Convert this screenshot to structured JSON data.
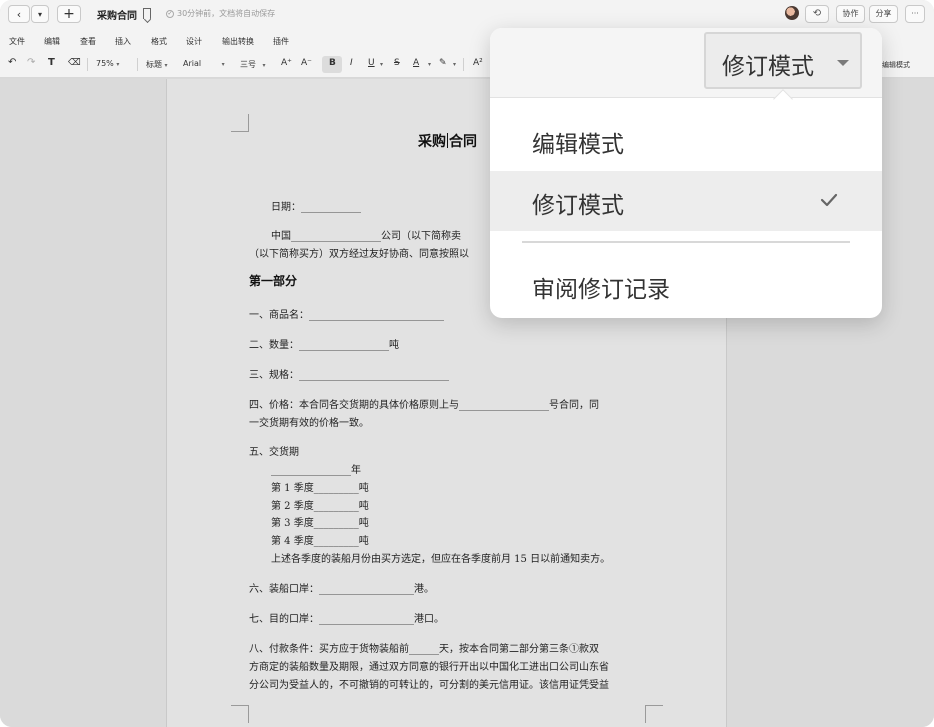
{
  "titlebar": {
    "back_icon": "‹",
    "dropdown_icon": "▾",
    "new_icon": "+",
    "doc_title": "采购合同",
    "save_status": "30分钟前，文档将自动保存",
    "history_icon": "⟲",
    "collab_label": "协作",
    "share_label": "分享",
    "more_icon": "···"
  },
  "menubar": {
    "items": [
      "文件",
      "编辑",
      "查看",
      "插入",
      "格式",
      "设计",
      "输出转换",
      "插件"
    ]
  },
  "toolbar": {
    "undo": "↶",
    "redo": "↷",
    "format_painter": "T",
    "eraser": "⌫",
    "zoom": "75%",
    "style": "标题",
    "font": "Arial",
    "size": "三号",
    "grow": "A⁺",
    "shrink": "A⁻",
    "bold": "B",
    "italic": "I",
    "underline": "U",
    "strike": "S",
    "font_color": "A",
    "highlight": "✎",
    "superscript": "A²",
    "mode_right": "编辑模式"
  },
  "document": {
    "title_a": "采购",
    "title_b": "合同",
    "date": "日期：____________",
    "intro1": "中国__________________公司（以下简称卖",
    "intro2": "（以下简称买方）双方经过友好协商、同意按照以",
    "part1": "第一部分",
    "item1": "一、商品名：___________________________",
    "item2": "二、数量：__________________吨",
    "item3": "三、规格：______________________________",
    "item4a": "四、价格：本合同各交货期的具体价格原则上与__________________号合同，同",
    "item4b": "一交货期有效的价格一致。",
    "item5": "五、交货期",
    "item5_year": "________________年",
    "q1": "第 1 季度_________吨",
    "q2": "第 2 季度_________吨",
    "q3": "第 3 季度_________吨",
    "q4": "第 4 季度_________吨",
    "item5_note": "上述各季度的装船月份由买方选定，但应在各季度前月 15 日以前通知卖方。",
    "item6": "六、装船口岸：___________________港。",
    "item7": "七、目的口岸：___________________港口。",
    "item8a": "八、付款条件：买方应于货物装船前______天，按本合同第二部分第三条①款双",
    "item8b": "方商定的装船数量及期限，通过双方同意的银行开出以中国化工进出口公司山东省",
    "item8c": "分公司为受益人的，不可撤销的可转让的，可分割的美元信用证。该信用证凭受益"
  },
  "mode_popover": {
    "current": "修订模式",
    "options": [
      {
        "label": "编辑模式",
        "selected": false
      },
      {
        "label": "修订模式",
        "selected": true
      }
    ],
    "review_label": "审阅修订记录"
  },
  "colors": {
    "background": "#d9d9d9",
    "page": "#e2e2e2",
    "popover": "#ffffff",
    "selected_row": "#ededed"
  }
}
